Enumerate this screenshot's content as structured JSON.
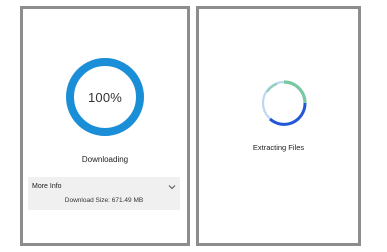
{
  "download_panel": {
    "progress_percent": 100,
    "progress_label": "100%",
    "status": "Downloading",
    "more_info": {
      "label": "More Info",
      "download_size": "Download Size: 671.49 MB",
      "chevron_icon": "chevron-down-icon"
    },
    "ring_color": "#1a8fd8"
  },
  "extract_panel": {
    "status": "Extracting Files",
    "spinner_icon": "loading-spinner-icon",
    "spinner_colors": [
      "#7ac7a4",
      "#2456d6",
      "#9ec8ee"
    ]
  }
}
